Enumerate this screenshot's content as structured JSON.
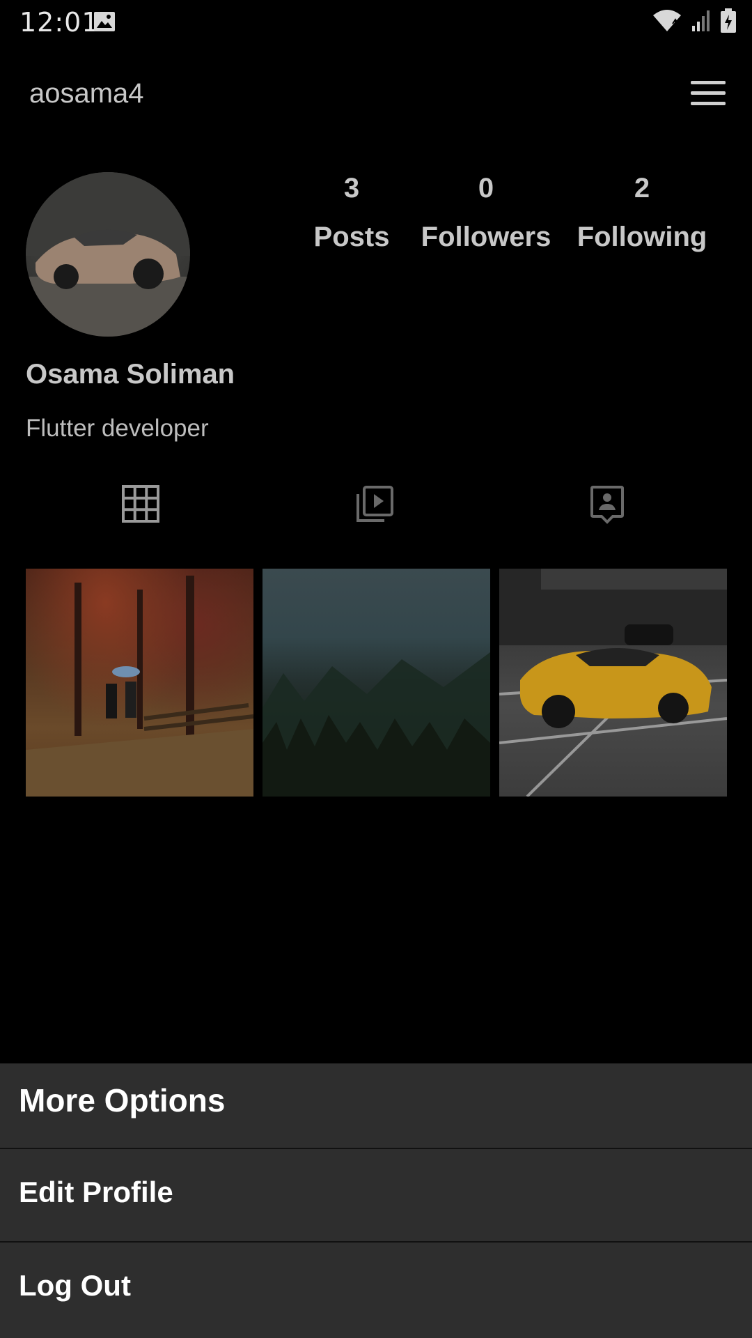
{
  "status_bar": {
    "time": "12:01"
  },
  "app_bar": {
    "username": "aosama4"
  },
  "profile": {
    "display_name": "Osama Soliman",
    "bio": "Flutter developer",
    "stats": {
      "posts": {
        "count": "3",
        "label": "Posts"
      },
      "followers": {
        "count": "0",
        "label": "Followers"
      },
      "following": {
        "count": "2",
        "label": "Following"
      }
    }
  },
  "tabs": [
    {
      "icon": "grid-icon"
    },
    {
      "icon": "reels-icon"
    },
    {
      "icon": "tagged-icon"
    }
  ],
  "posts": [
    {
      "subject": "autumn-forest-couple-photo"
    },
    {
      "subject": "misty-forest-photo"
    },
    {
      "subject": "yellow-sports-car-photo"
    }
  ],
  "sheet": {
    "title": "More Options",
    "items": [
      "Edit Profile",
      "Log Out"
    ]
  }
}
